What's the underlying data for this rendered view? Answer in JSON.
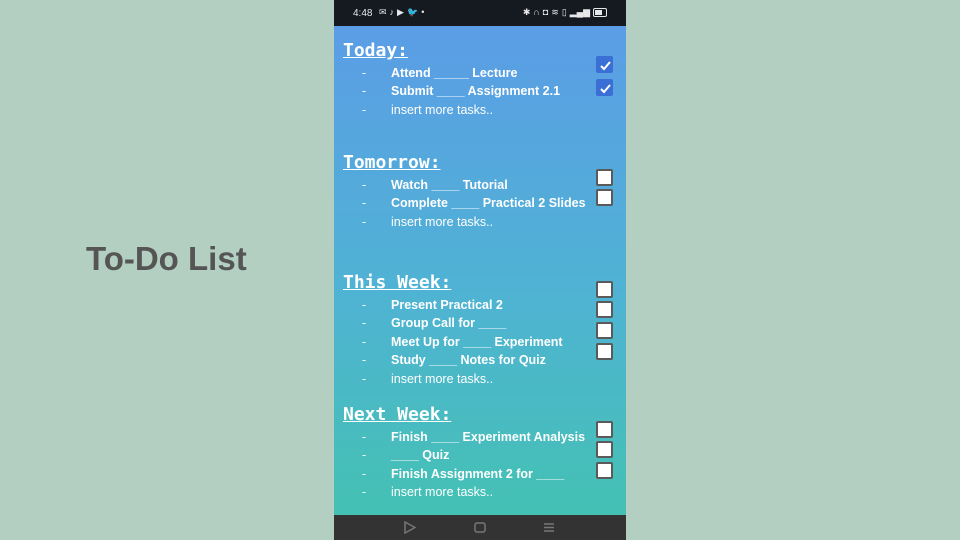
{
  "slide_title": "To-Do List",
  "status_bar": {
    "time": "4:48",
    "app_icons": [
      "mail-icon",
      "tiktok-icon",
      "youtube-icon",
      "twitter-icon",
      "dot-icon"
    ],
    "system_icons": [
      "bluetooth-icon",
      "headset-icon",
      "vibrate-icon",
      "wifi-icon",
      "sim-icon",
      "signal-icon",
      "battery-icon"
    ]
  },
  "sections": [
    {
      "title": "Today:",
      "tasks": [
        {
          "label": "Attend _____ Lecture",
          "checked": true
        },
        {
          "label": "Submit ____ Assignment 2.1",
          "checked": true
        }
      ],
      "placeholder": "insert more tasks.."
    },
    {
      "title": "Tomorrow:",
      "tasks": [
        {
          "label": "Watch ____ Tutorial",
          "checked": false
        },
        {
          "label": "Complete ____ Practical 2 Slides",
          "checked": false
        }
      ],
      "placeholder": "insert more tasks.."
    },
    {
      "title": "This Week:",
      "tasks": [
        {
          "label": "Present Practical 2",
          "checked": false
        },
        {
          "label": "Group Call for ____",
          "checked": false
        },
        {
          "label": "Meet Up for ____ Experiment",
          "checked": false
        },
        {
          "label": "Study ____ Notes for Quiz",
          "checked": false
        }
      ],
      "placeholder": "insert more tasks.."
    },
    {
      "title": "Next Week:",
      "tasks": [
        {
          "label": "Finish  ____ Experiment Analysis",
          "checked": false
        },
        {
          "label": "____ Quiz",
          "checked": false
        },
        {
          "label": "Finish Assignment 2 for ____",
          "checked": false
        }
      ],
      "placeholder": "insert more tasks.."
    }
  ],
  "dash": "-",
  "nav_bar": {
    "buttons": [
      "back-icon",
      "home-icon",
      "recents-icon"
    ]
  },
  "colors": {
    "background": "#b2cfc2",
    "gradient_top": "#5b9de6",
    "gradient_bottom": "#44c1b3",
    "checkbox_checked": "#3a6fd6"
  }
}
